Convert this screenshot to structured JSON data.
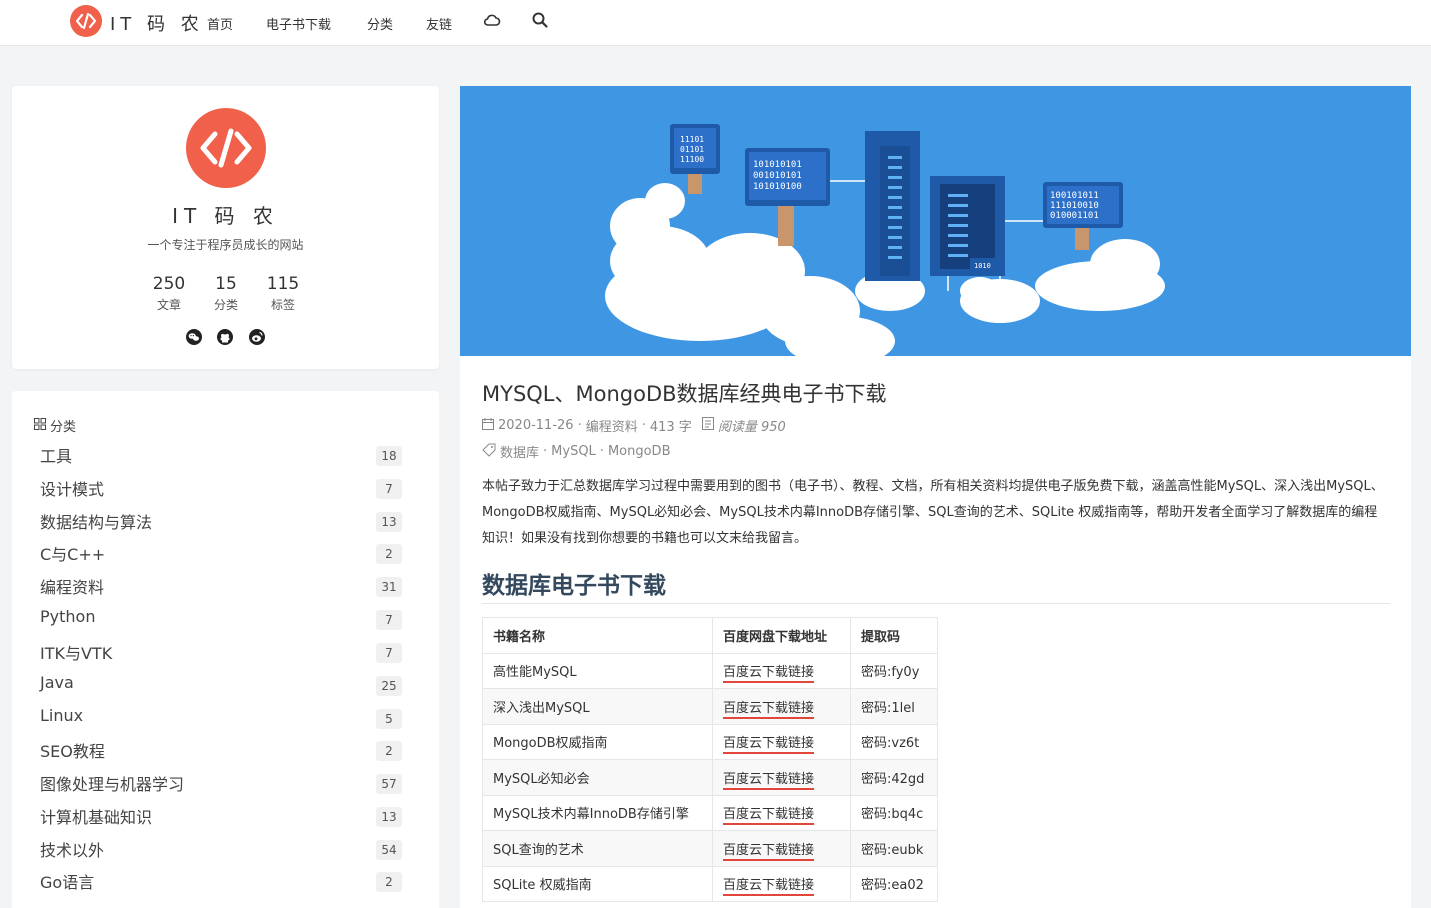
{
  "nav": {
    "brand": "IT 码 农",
    "links": [
      "首页",
      "电子书下载",
      "分类",
      "友链"
    ]
  },
  "profile": {
    "name": "IT 码 农",
    "description": "一个专注于程序员成长的网站",
    "stats": [
      {
        "num": "250",
        "label": "文章"
      },
      {
        "num": "15",
        "label": "分类"
      },
      {
        "num": "115",
        "label": "标签"
      }
    ],
    "social_icons": [
      "wechat-icon",
      "github-icon",
      "weibo-icon"
    ]
  },
  "categories": {
    "heading": "分类",
    "items": [
      {
        "name": "工具",
        "count": "18"
      },
      {
        "name": "设计模式",
        "count": "7"
      },
      {
        "name": "数据结构与算法",
        "count": "13"
      },
      {
        "name": "C与C++",
        "count": "2"
      },
      {
        "name": "编程资料",
        "count": "31"
      },
      {
        "name": "Python",
        "count": "7"
      },
      {
        "name": "ITK与VTK",
        "count": "7"
      },
      {
        "name": "Java",
        "count": "25"
      },
      {
        "name": "Linux",
        "count": "5"
      },
      {
        "name": "SEO教程",
        "count": "2"
      },
      {
        "name": "图像处理与机器学习",
        "count": "57"
      },
      {
        "name": "计算机基础知识",
        "count": "13"
      },
      {
        "name": "技术以外",
        "count": "54"
      },
      {
        "name": "Go语言",
        "count": "2"
      }
    ]
  },
  "post": {
    "title": "MYSQL、MongoDB数据库经典电子书下载",
    "date": "2020-11-26",
    "category": "编程资料",
    "words": "413 字",
    "views": "阅读量 950",
    "tags": [
      "数据库",
      "MySQL",
      "MongoDB"
    ],
    "intro": "本帖子致力于汇总数据库学习过程中需要用到的图书（电子书）、教程、文档，所有相关资料均提供电子版免费下载，涵盖高性能MySQL、深入浅出MySQL、MongoDB权威指南、MySQL必知必会、MySQL技术内幕InnoDB存储引擎、SQL查询的艺术、SQLite 权威指南等，帮助开发者全面学习了解数据库的编程知识！如果没有找到你想要的书籍也可以文末给我留言。",
    "section_heading": "数据库电子书下载",
    "banner_texts": [
      "11101",
      "01101",
      "11100",
      "101010101",
      "001010101",
      "101010100",
      "100101011",
      "111010010",
      "010001101",
      "1010"
    ]
  },
  "table": {
    "headers": [
      "书籍名称",
      "百度网盘下载地址",
      "提取码"
    ],
    "rows": [
      [
        "高性能MySQL",
        "百度云下载链接",
        "密码:fy0y"
      ],
      [
        "深入浅出MySQL",
        "百度云下载链接",
        "密码:1lel"
      ],
      [
        "MongoDB权威指南",
        "百度云下载链接",
        "密码:vz6t"
      ],
      [
        "MySQL必知必会",
        "百度云下载链接",
        "密码:42gd"
      ],
      [
        "MySQL技术内幕InnoDB存储引擎",
        "百度云下载链接",
        "密码:bq4c"
      ],
      [
        "SQL查询的艺术",
        "百度云下载链接",
        "密码:eubk"
      ],
      [
        "SQLite 权威指南",
        "百度云下载链接",
        "密码:ea02"
      ]
    ]
  },
  "colors": {
    "brand": "#f0604a",
    "banner": "#3f97e3",
    "link_underline": "#e0463a"
  }
}
